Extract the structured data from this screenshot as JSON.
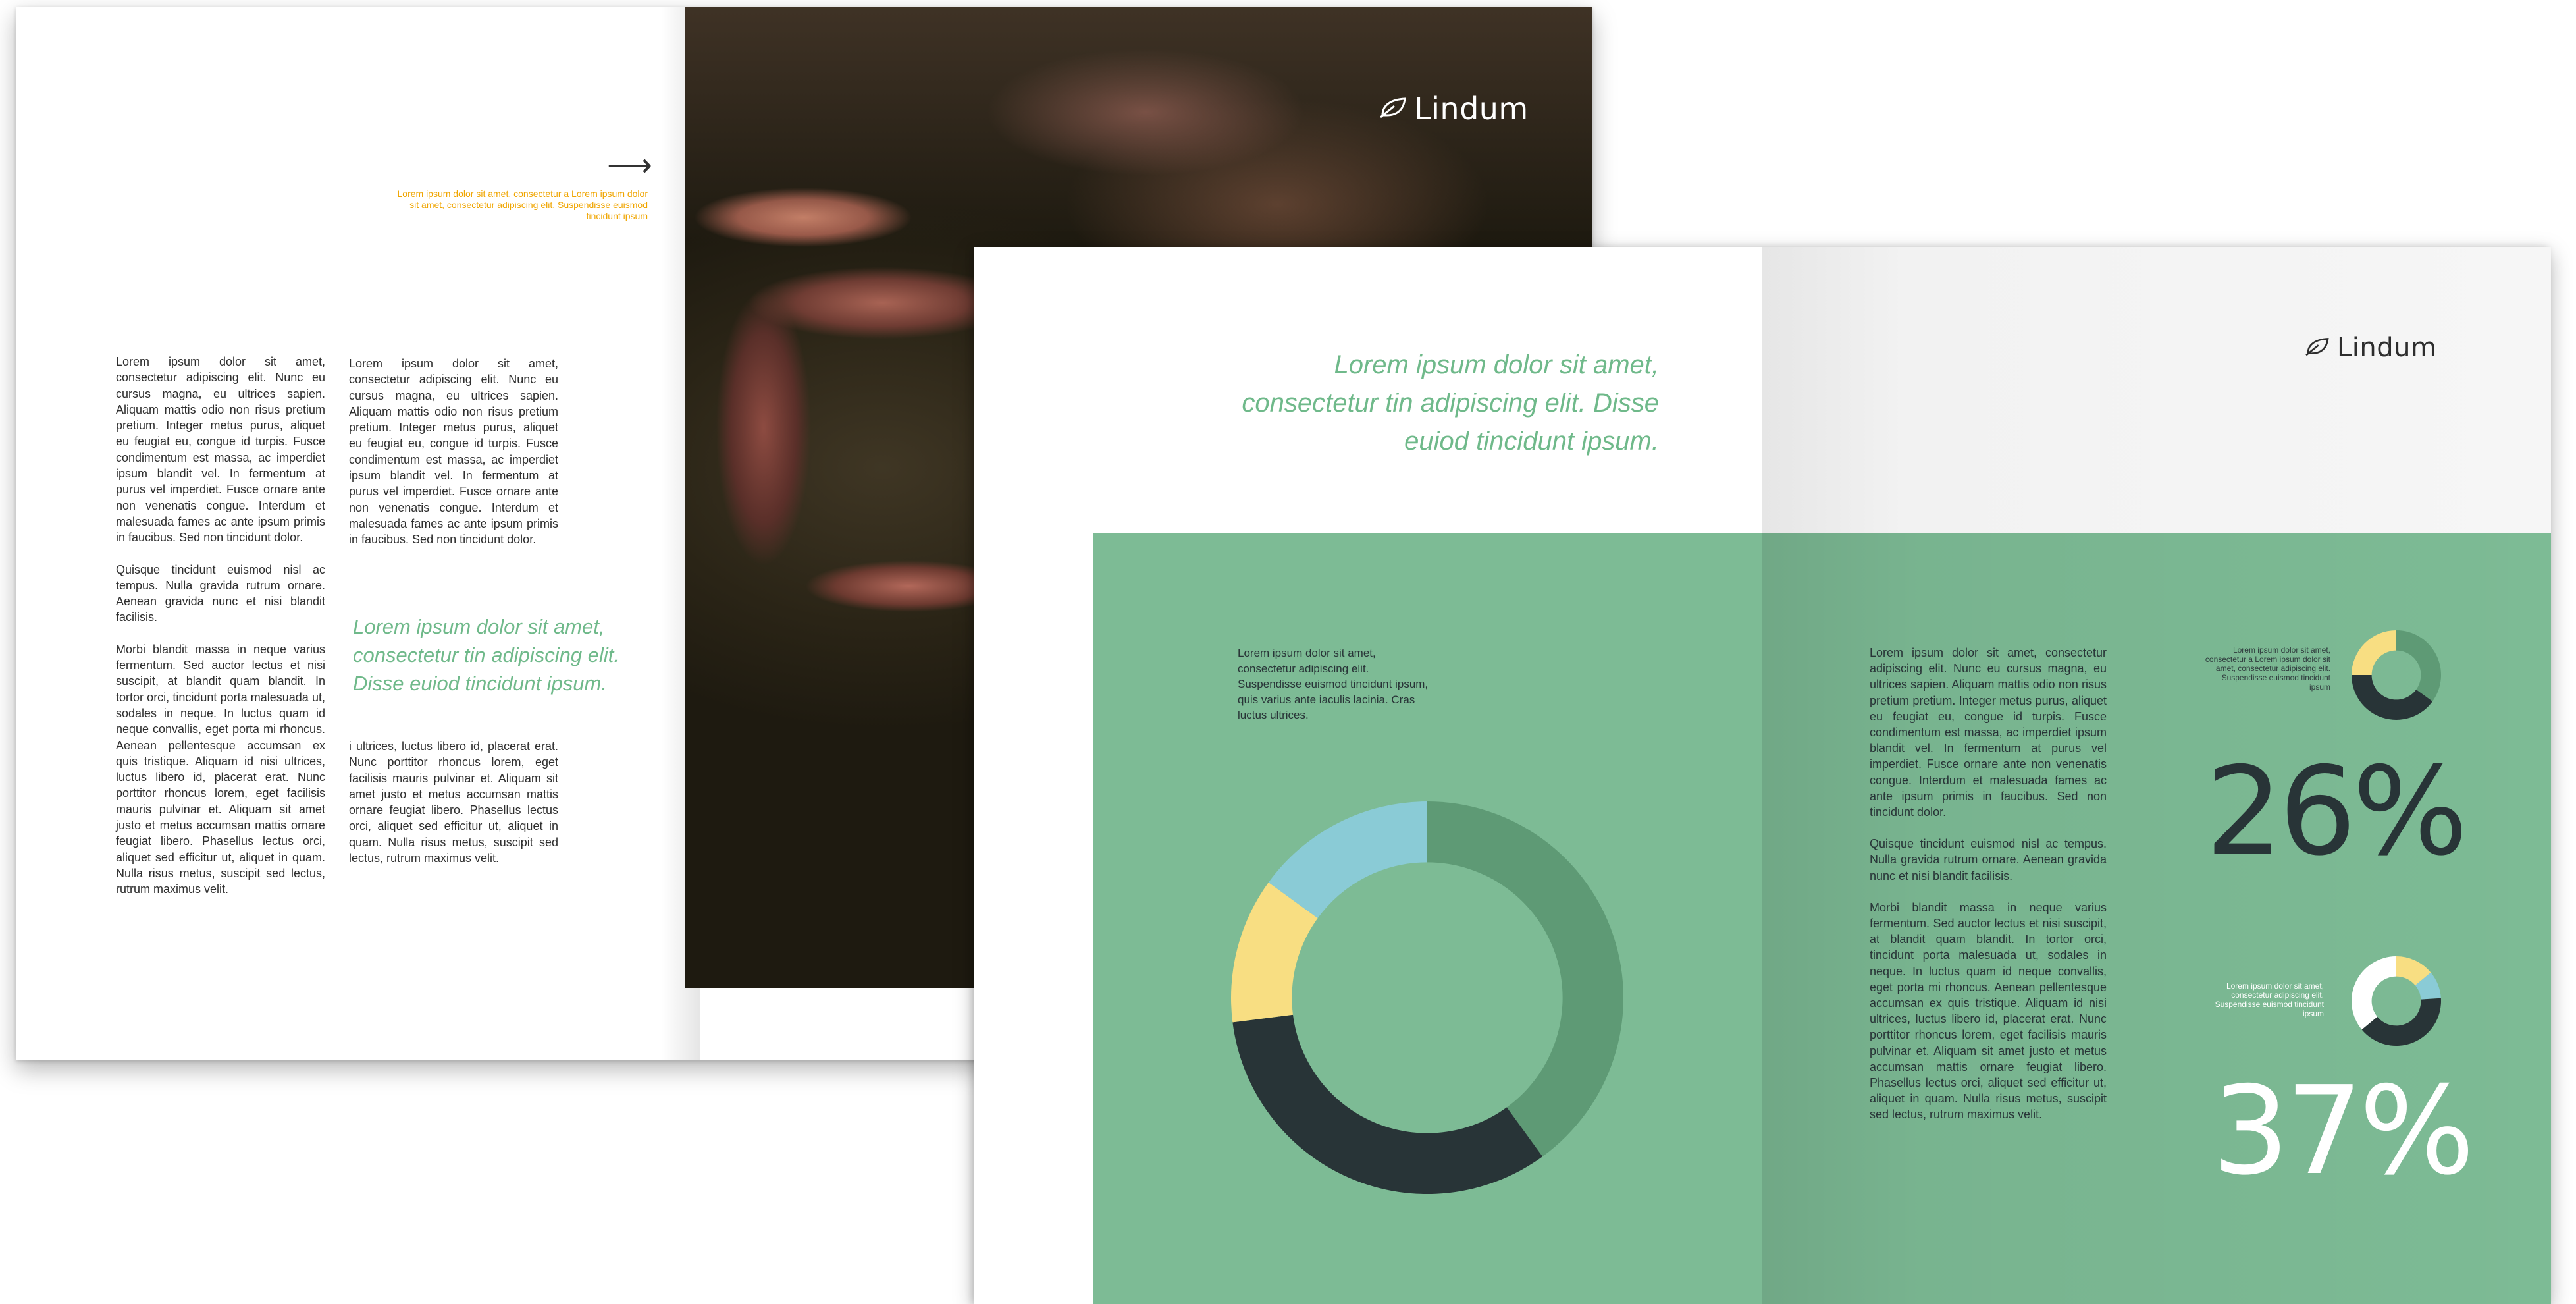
{
  "brand": {
    "name": "Lindum",
    "logo_icon": "leaf-icon"
  },
  "colors": {
    "green_panel": "#7dbb95",
    "accent_green": "#6fb98a",
    "accent_orange": "#f0a500",
    "dark": "#283437"
  },
  "back_spread": {
    "arrow": "⟶",
    "note": "Lorem ipsum dolor sit amet, consectetur a Lorem ipsum dolor sit amet, consectetur adipiscing elit. Suspendisse euismod tincidunt ipsum",
    "col1_p1": "Lorem ipsum dolor sit amet, consectetur adipiscing elit. Nunc eu cursus magna, eu ultrices sapien. Aliquam mattis odio non risus pretium pretium. Integer metus purus, aliquet eu feugiat eu, congue id turpis. Fusce condimentum est massa, ac imperdiet ipsum blandit vel. In fermentum at purus vel imperdiet. Fusce ornare ante non venenatis congue. Interdum et malesuada fames ac ante ipsum primis in faucibus. Sed non tincidunt dolor.",
    "col1_p2": "Quisque tincidunt euismod nisl ac tempus. Nulla gravida rutrum ornare. Aenean gravida nunc et nisi blandit facilisis.",
    "col1_p3": "Morbi blandit massa in neque varius fermentum. Sed auctor lectus et nisi suscipit, at blandit quam blandit. In tortor orci, tincidunt porta malesuada ut, sodales in neque. In luctus quam id neque convallis, eget porta mi rhoncus. Aenean pellentesque accumsan ex quis tristique. Aliquam id nisi ultrices, luctus libero id, placerat erat. Nunc porttitor rhoncus lorem, eget facilisis mauris pulvinar et. Aliquam sit amet justo et metus accumsan mattis ornare feugiat libero. Phasellus lectus orci, aliquet sed efficitur ut, aliquet in quam. Nulla risus metus, suscipit sed lectus, rutrum maximus velit.",
    "col2_p1": "Lorem ipsum dolor sit amet, consectetur adipiscing elit. Nunc eu cursus magna, eu ultrices sapien. Aliquam mattis odio non risus pretium pretium. Integer metus purus, aliquet eu feugiat eu, congue id turpis. Fusce condimentum est massa, ac imperdiet ipsum blandit vel. In fermentum at purus vel imperdiet. Fusce ornare ante non venenatis congue. Interdum et malesuada fames ac ante ipsum primis in faucibus. Sed non tincidunt dolor.",
    "pull_quote": "Lorem ipsum dolor sit amet, consectetur tin adipiscing elit. Disse euiod tincidunt ipsum.",
    "col3_p1": "i ultrices, luctus libero id, placerat erat. Nunc porttitor rhoncus lorem, eget facilisis mauris pulvinar et. Aliquam sit amet justo et metus accumsan mattis ornare feugiat libero. Phasellus lectus orci, aliquet sed efficitur ut, aliquet in quam. Nulla risus metus, suscipit sed lectus, rutrum maximus velit."
  },
  "front_spread": {
    "heading": "Lorem ipsum dolor sit amet, consectetur tin adipiscing elit. Disse euiod tincidunt ipsum.",
    "chart_caption": "Lorem ipsum dolor sit amet, consectetur adipiscing elit. Suspendisse euismod tincidunt ipsum, quis varius ante iaculis lacinia. Cras luctus ultrices.",
    "body_p1": "Lorem ipsum dolor sit amet, consectetur adipiscing elit. Nunc eu cursus magna, eu ultrices sapien. Aliquam mattis odio non risus pretium pretium. Integer metus purus, aliquet eu feugiat eu, congue id turpis. Fusce condimentum est massa, ac imperdiet ipsum blandit vel. In fermentum at purus vel imperdiet. Fusce ornare ante non venenatis congue. Interdum et malesuada fames ac ante ipsum primis in faucibus. Sed non tincidunt dolor.",
    "body_p2": "Quisque tincidunt euismod nisl ac tempus. Nulla gravida rutrum ornare. Aenean gravida nunc et nisi blandit facilisis.",
    "body_p3": "Morbi blandit massa in neque varius fermentum. Sed auctor lectus et nisi suscipit, at blandit quam blandit. In tortor orci, tincidunt porta malesuada ut, sodales in neque. In luctus quam id neque convallis, eget porta mi rhoncus. Aenean pellentesque accumsan ex quis tristique. Aliquam id nisi ultrices, luctus libero id, placerat erat. Nunc porttitor rhoncus lorem, eget facilisis mauris pulvinar et. Aliquam sit amet justo et metus accumsan mattis ornare feugiat libero. Phasellus lectus orci, aliquet sed efficitur ut, aliquet in quam. Nulla risus metus, suscipit sed lectus, rutrum maximus velit.",
    "stat1": {
      "note": "Lorem ipsum dolor sit amet, consectetur a Lorem ipsum dolor sit amet, consectetur adipiscing elit. Suspendisse euismod tincidunt ipsum",
      "value": "26%"
    },
    "stat2": {
      "note": "Lorem ipsum dolor sit amet, consectetur adipiscing elit. Suspendisse euismod tincidunt ipsum",
      "value": "37%"
    }
  },
  "donuts": {
    "big": [
      {
        "value": 0.4,
        "color": "#5e9a75"
      },
      {
        "value": 0.33,
        "color": "#283437"
      },
      {
        "value": 0.12,
        "color": "#f8de82"
      },
      {
        "value": 0.15,
        "color": "#8acbd6"
      }
    ],
    "small1": [
      {
        "value": 0.35,
        "color": "#5e9a75"
      },
      {
        "value": 0.4,
        "color": "#283437"
      },
      {
        "value": 0.25,
        "color": "#f8de82"
      }
    ],
    "small2": [
      {
        "value": 0.14,
        "color": "#f8de82"
      },
      {
        "value": 0.1,
        "color": "#8acbd6"
      },
      {
        "value": 0.4,
        "color": "#283437"
      },
      {
        "value": 0.36,
        "color": "#ffffff"
      }
    ]
  }
}
